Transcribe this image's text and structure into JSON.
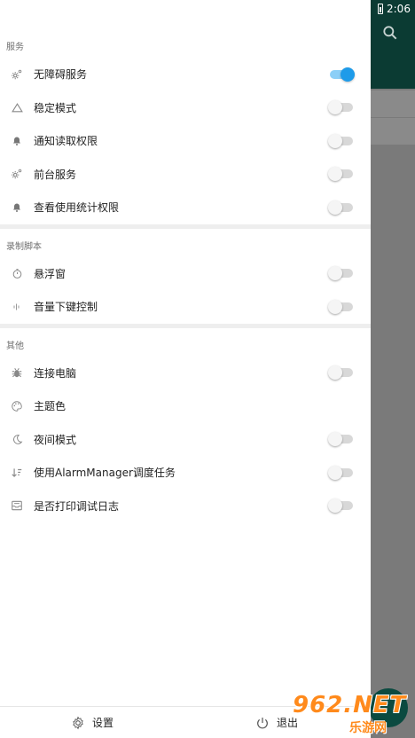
{
  "status_bar": {
    "time": "2:06"
  },
  "sections": [
    {
      "header": "服务",
      "items": [
        {
          "icon": "gear-icon",
          "label": "无障碍服务",
          "toggle": true
        },
        {
          "icon": "triangle-icon",
          "label": "稳定模式",
          "toggle": false
        },
        {
          "icon": "bell-icon",
          "label": "通知读取权限",
          "toggle": false
        },
        {
          "icon": "gear-icon",
          "label": "前台服务",
          "toggle": false
        },
        {
          "icon": "bell-icon",
          "label": "查看使用统计权限",
          "toggle": false
        }
      ]
    },
    {
      "header": "录制脚本",
      "items": [
        {
          "icon": "timer-icon",
          "label": "悬浮窗",
          "toggle": false
        },
        {
          "icon": "volume-icon",
          "label": "音量下键控制",
          "toggle": false
        }
      ]
    },
    {
      "header": "其他",
      "items": [
        {
          "icon": "bug-icon",
          "label": "连接电脑",
          "toggle": false
        },
        {
          "icon": "palette-icon",
          "label": "主题色",
          "toggle": null
        },
        {
          "icon": "moon-icon",
          "label": "夜间模式",
          "toggle": false
        },
        {
          "icon": "sort-icon",
          "label": "使用AlarmManager调度任务",
          "toggle": false
        },
        {
          "icon": "log-icon",
          "label": "是否打印调试日志",
          "toggle": false
        }
      ]
    }
  ],
  "bottom": {
    "settings_label": "设置",
    "exit_label": "退出"
  },
  "watermark": {
    "main": "962.NET",
    "sub": "乐游网"
  },
  "colors": {
    "accent": "#1e9be9",
    "toolbar": "#0b3b33"
  }
}
